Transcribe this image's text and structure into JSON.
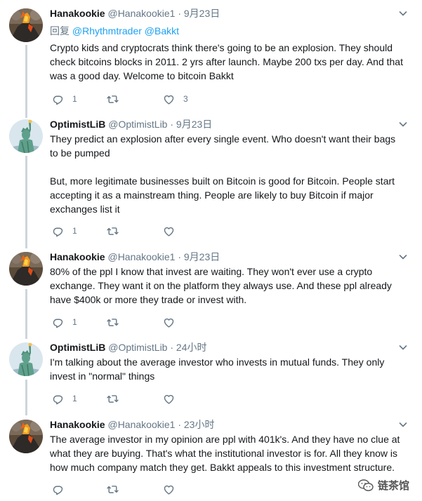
{
  "tweets": [
    {
      "name": "Hanakookie",
      "handle": "@Hanakookie1",
      "time": "9月23日",
      "reply_prefix": "回复 ",
      "reply_mentions": "@Rhythmtrader @Bakkt",
      "paragraphs": [
        "Crypto kids and cryptocrats think there's going to be an explosion. They should check bitcoins blocks in 2011. 2 yrs after launch. Maybe 200 txs per day. And that was a good day. Welcome to bitcoin Bakkt"
      ],
      "replies": "1",
      "retweets": "",
      "likes": "3",
      "avatar": "volcano"
    },
    {
      "name": "OptimistLiB",
      "handle": "@OptimistLib",
      "time": "9月23日",
      "paragraphs": [
        "They predict an explosion after every single event. Who doesn't want their bags to be pumped",
        "But, more legitimate businesses built on Bitcoin is good for Bitcoin. People start accepting it as a mainstream thing. People are likely to buy Bitcoin if major exchanges list it"
      ],
      "replies": "1",
      "retweets": "",
      "likes": "",
      "avatar": "liberty"
    },
    {
      "name": "Hanakookie",
      "handle": "@Hanakookie1",
      "time": "9月23日",
      "paragraphs": [
        "80% of the ppl I know that invest are waiting. They won't ever use a crypto exchange. They want it on the platform they always use. And these ppl already have $400k or more they trade or invest with."
      ],
      "replies": "1",
      "retweets": "",
      "likes": "",
      "avatar": "volcano"
    },
    {
      "name": "OptimistLiB",
      "handle": "@OptimistLib",
      "time": "24小时",
      "paragraphs": [
        "I'm talking about the average investor who invests in mutual funds. They only invest in \"normal\" things"
      ],
      "replies": "1",
      "retweets": "",
      "likes": "",
      "avatar": "liberty"
    },
    {
      "name": "Hanakookie",
      "handle": "@Hanakookie1",
      "time": "23小时",
      "paragraphs": [
        "The average investor in my opinion are ppl with 401k's. And they have no clue at what they are buying. That's what the institutional investor is for. All they know is how much company match they get. Bakkt appeals to this investment structure."
      ],
      "replies": "",
      "retweets": "",
      "likes": "",
      "avatar": "volcano"
    }
  ],
  "watermark": "链茶馆",
  "colors": {
    "text": "#14171a",
    "muted": "#657786",
    "link": "#1da1f2",
    "thread": "#ccd6dd"
  }
}
